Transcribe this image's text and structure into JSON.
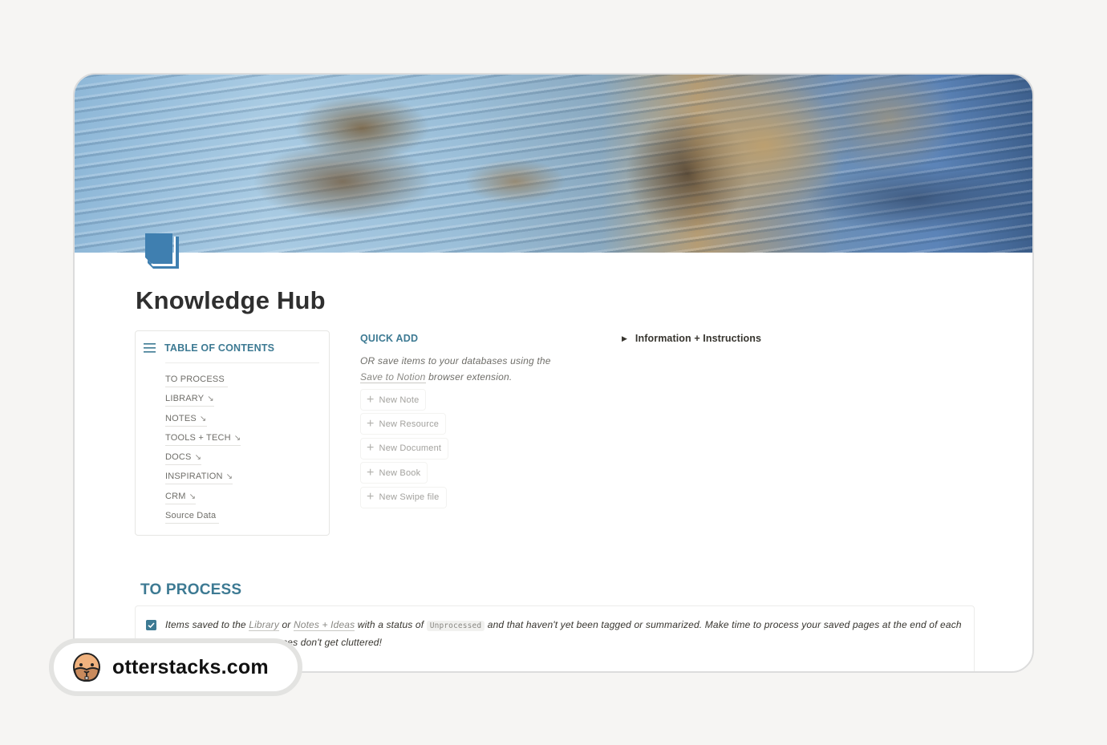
{
  "page": {
    "title": "Knowledge Hub",
    "icon": "book-icon",
    "cover": "weathered-wood-cover-image"
  },
  "toc": {
    "title": "TABLE OF CONTENTS",
    "icon": "list-icon",
    "items": [
      {
        "label": "TO PROCESS",
        "arrow": ""
      },
      {
        "label": "LIBRARY",
        "arrow": "↘"
      },
      {
        "label": "NOTES",
        "arrow": "↘"
      },
      {
        "label": "TOOLS + TECH",
        "arrow": "↘"
      },
      {
        "label": "DOCS",
        "arrow": "↘"
      },
      {
        "label": "INSPIRATION",
        "arrow": "↘"
      },
      {
        "label": "CRM",
        "arrow": "↘"
      },
      {
        "label": "Source Data",
        "arrow": ""
      }
    ]
  },
  "quick_add": {
    "title": "QUICK ADD",
    "note_prefix": "OR save items to your databases using the",
    "note_link": "Save to Notion",
    "note_suffix": "browser extension.",
    "buttons": [
      {
        "label": "New Note"
      },
      {
        "label": "New Resource"
      },
      {
        "label": "New Document"
      },
      {
        "label": "New Book"
      },
      {
        "label": "New Swipe file"
      }
    ]
  },
  "toggle": {
    "label": "Information + Instructions"
  },
  "to_process": {
    "heading": "TO PROCESS",
    "checked": true,
    "text_1": "Items saved to the",
    "link_1": "Library",
    "text_2": "or",
    "link_2": "Notes + Ideas",
    "text_3": "with a status of",
    "status_code": "Unprocessed",
    "text_4": "and that haven't yet been tagged or summarized. Make time to process your saved pages at the end of each dav/week so you're databases don't get cluttered!"
  },
  "badge": {
    "site": "otterstacks.com",
    "icon": "otter-face-icon"
  },
  "colors": {
    "accent": "#3d7a93",
    "background": "#f6f5f3"
  }
}
